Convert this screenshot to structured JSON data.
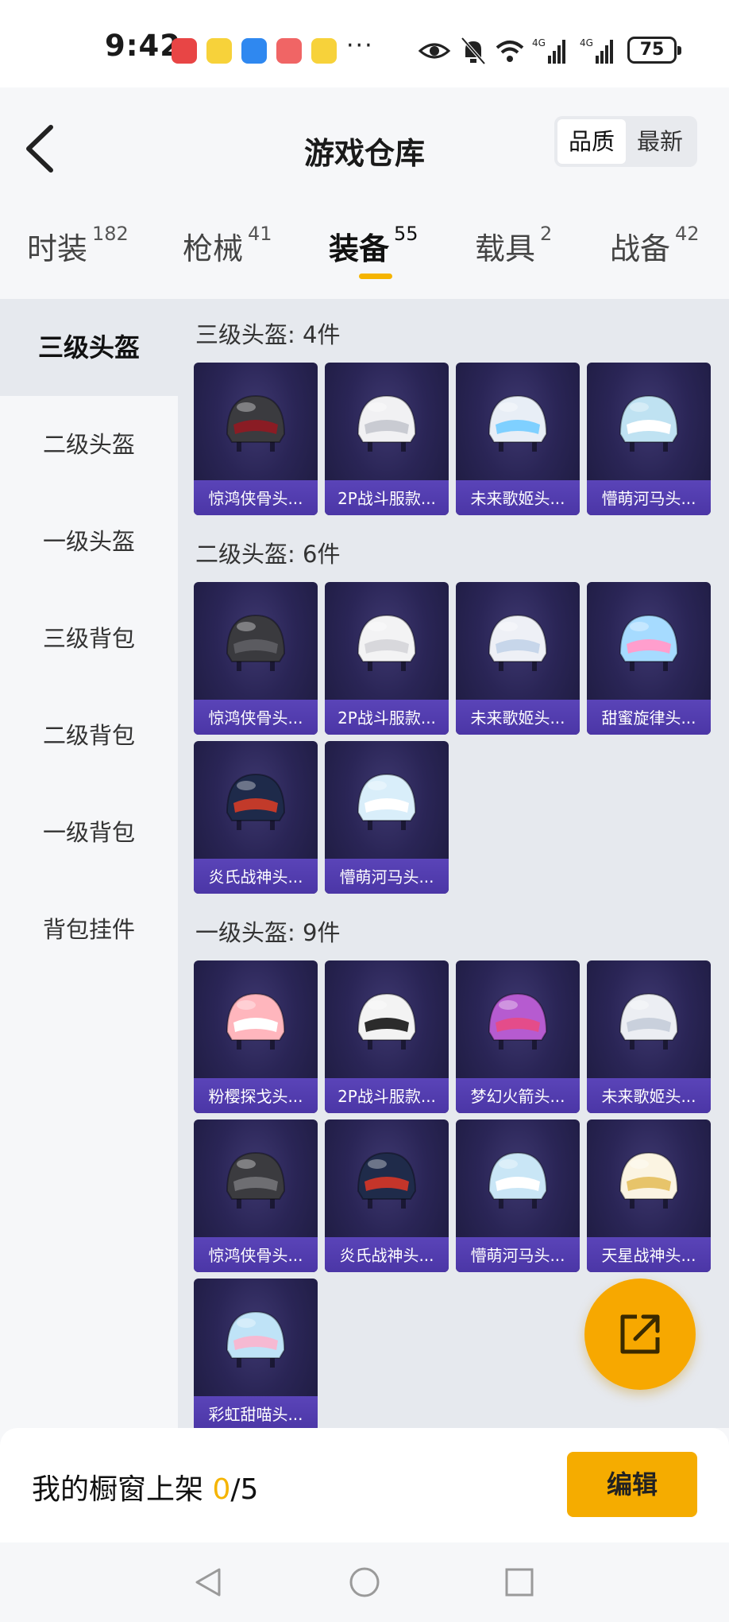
{
  "status_bar": {
    "time": "9:42",
    "battery": "75",
    "more": "···"
  },
  "header": {
    "title": "游戏仓库",
    "sort_options": [
      "品质",
      "最新"
    ]
  },
  "tabs": [
    {
      "label": "时装",
      "count": "182"
    },
    {
      "label": "枪械",
      "count": "41"
    },
    {
      "label": "装备",
      "count": "55"
    },
    {
      "label": "载具",
      "count": "2"
    },
    {
      "label": "战备",
      "count": "42"
    }
  ],
  "sidebar": [
    "三级头盔",
    "二级头盔",
    "一级头盔",
    "三级背包",
    "二级背包",
    "一级背包",
    "背包挂件"
  ],
  "sections": [
    {
      "title": "三级头盔: 4件",
      "items": [
        "惊鸿侠骨头...",
        "2P战斗服款...",
        "未来歌姬头...",
        "懵萌河马头..."
      ]
    },
    {
      "title": "二级头盔: 6件",
      "items": [
        "惊鸿侠骨头...",
        "2P战斗服款...",
        "未来歌姬头...",
        "甜蜜旋律头...",
        "炎氏战神头...",
        "懵萌河马头..."
      ]
    },
    {
      "title": "一级头盔: 9件",
      "items": [
        "粉樱探戈头...",
        "2P战斗服款...",
        "梦幻火箭头...",
        "未来歌姬头...",
        "惊鸿侠骨头...",
        "炎氏战神头...",
        "懵萌河马头...",
        "天星战神头...",
        "彩虹甜喵头..."
      ]
    }
  ],
  "bottom": {
    "shelf_label": "我的橱窗上架 ",
    "shelf_count": "0",
    "shelf_total": "/5",
    "edit_label": "编辑"
  },
  "colors": {
    "accent": "#f5b400",
    "card_bg": "#2a2556",
    "card_label": "#4b36a6"
  }
}
